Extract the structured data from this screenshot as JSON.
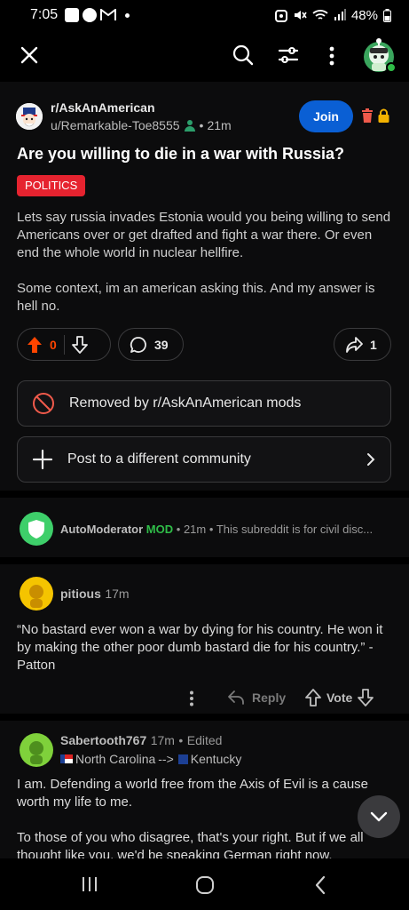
{
  "status_bar": {
    "time": "7:05",
    "battery": "48%"
  },
  "post": {
    "subreddit": "r/AskAnAmerican",
    "author": "u/Remarkable-Toe8555",
    "age": "21m",
    "join_label": "Join",
    "title": "Are you willing to die in a war with Russia?",
    "flair": "POLITICS",
    "body": [
      "Lets say russia invades Estonia would you being willing to send Americans over or get drafted and fight a war there. Or even end the whole world in nuclear hellfire.",
      "Some context, im an american asking this. And my answer is hell no."
    ],
    "score": "0",
    "comments_count": "39",
    "shares_count": "1",
    "removed_label": "Removed by r/AskAnAmerican mods",
    "crosspost_label": "Post to a different community"
  },
  "comments": [
    {
      "author": "AutoModerator",
      "mod_tag": "MOD",
      "age": "21m",
      "preview": "This subreddit is for civil disc..."
    },
    {
      "author": "pitious",
      "age": "17m",
      "body": "“No bastard ever won a war by dying for his country. He won it by making the other poor dumb bastard die for his country.” -Patton",
      "reply_label": "Reply",
      "vote_label": "Vote"
    },
    {
      "author": "Sabertooth767",
      "age": "17m",
      "edited": "Edited",
      "flair_from": "North Carolina",
      "flair_arrow": "-->",
      "flair_to": "Kentucky",
      "body_1": "I am. Defending a world free from the Axis of Evil is a cause worth my life to me.",
      "body_2": "To those of you who disagree, that's your right. But if we all thought like you, we'd be speaking German right now."
    }
  ],
  "colors": {
    "accent_join": "#0a5fd4",
    "flair_red": "#e6232f",
    "upvote_orange": "#ff4500",
    "mod_green": "#2fbd48"
  },
  "icons": [
    "close-icon",
    "search-icon",
    "filter-icon",
    "more-icon",
    "user-avatar",
    "delete-icon",
    "lock-icon",
    "upvote-icon",
    "downvote-icon",
    "comment-icon",
    "share-icon",
    "removed-icon",
    "plus-icon",
    "chevron-right-icon",
    "shield-icon",
    "chevron-down-icon"
  ]
}
